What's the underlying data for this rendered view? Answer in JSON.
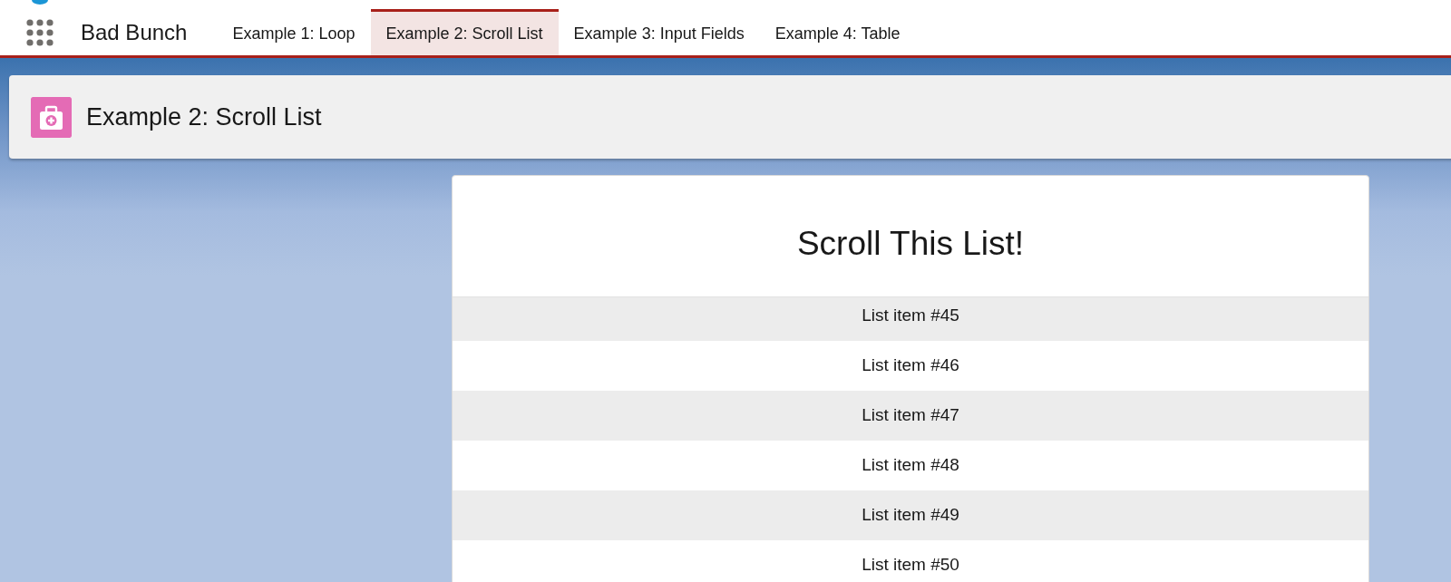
{
  "app": {
    "name": "Bad Bunch"
  },
  "nav_tabs": [
    {
      "label": "Example 1: Loop",
      "selected": false
    },
    {
      "label": "Example 2: Scroll List",
      "selected": true
    },
    {
      "label": "Example 3: Input Fields",
      "selected": false
    },
    {
      "label": "Example 4: Table",
      "selected": false
    }
  ],
  "page_header": {
    "title": "Example 2: Scroll List"
  },
  "card": {
    "title": "Scroll This List!",
    "items": [
      "List item #45",
      "List item #46",
      "List item #47",
      "List item #48",
      "List item #49",
      "List item #50"
    ]
  }
}
